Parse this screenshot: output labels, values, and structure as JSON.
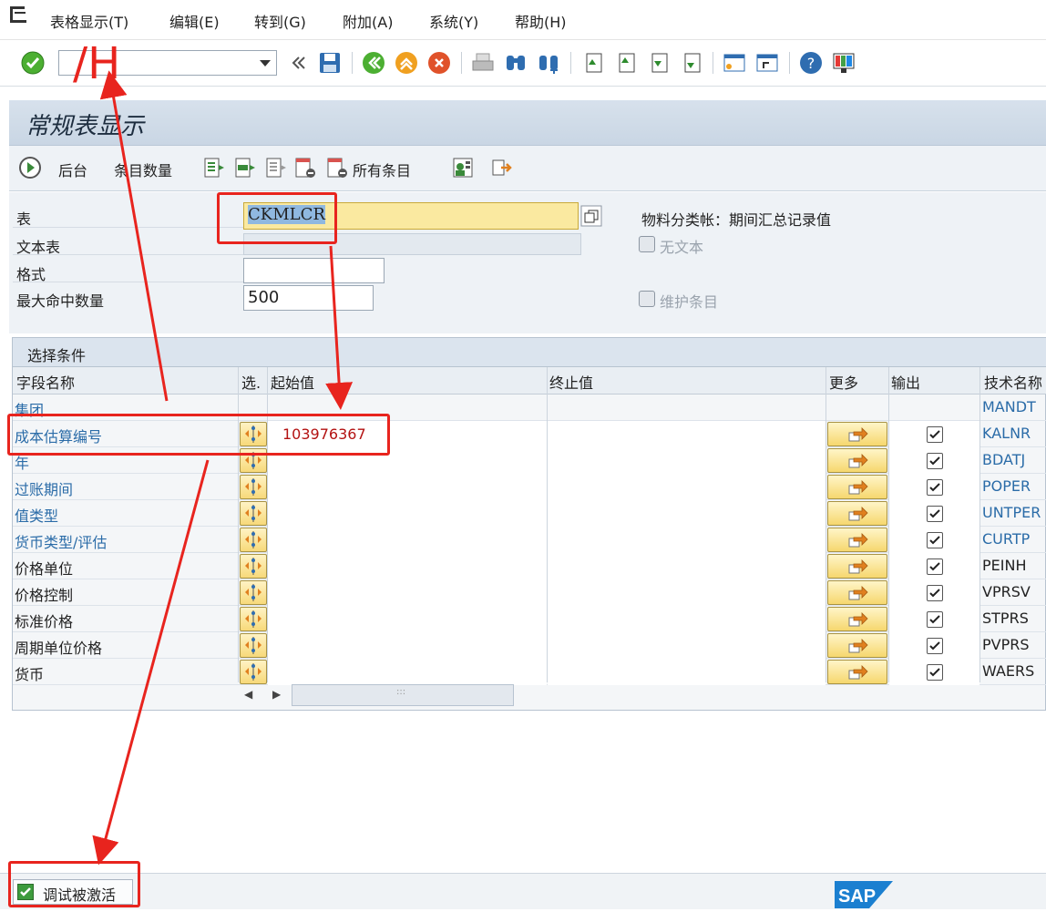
{
  "menu": {
    "items": [
      "表格显示(T)",
      "编辑(E)",
      "转到(G)",
      "附加(A)",
      "系统(Y)",
      "帮助(H)"
    ]
  },
  "toolbar": {
    "command_value": ""
  },
  "title": "常规表显示",
  "app_toolbar": {
    "background_label": "后台",
    "entry_count_label": "条目数量",
    "all_entries_label": "所有条目"
  },
  "form": {
    "table_label": "表",
    "table_value": "CKMLCR",
    "table_description": "物料分类帐：期间汇总记录值",
    "text_table_label": "文本表",
    "no_text_label": "无文本",
    "format_label": "格式",
    "max_hits_label": "最大命中数量",
    "max_hits_value": "500",
    "maintain_entries_label": "维护条目"
  },
  "selection": {
    "title": "选择条件",
    "columns": {
      "field_name": "字段名称",
      "select": "选.",
      "from_value": "起始值",
      "to_value": "终止值",
      "more": "更多",
      "output": "输出",
      "tech_name": "技术名称"
    },
    "rows": [
      {
        "name": "集团",
        "tech": "MANDT",
        "from": "",
        "blue": true,
        "editable": false
      },
      {
        "name": "成本估算编号",
        "tech": "KALNR",
        "from": "103976367",
        "blue": true,
        "editable": true
      },
      {
        "name": "年",
        "tech": "BDATJ",
        "from": "",
        "blue": true,
        "editable": true
      },
      {
        "name": "过账期间",
        "tech": "POPER",
        "from": "",
        "blue": true,
        "editable": true
      },
      {
        "name": "值类型",
        "tech": "UNTPER",
        "from": "",
        "blue": true,
        "editable": true
      },
      {
        "name": "货币类型/评估",
        "tech": "CURTP",
        "from": "",
        "blue": true,
        "editable": true
      },
      {
        "name": "价格单位",
        "tech": "PEINH",
        "from": "",
        "blue": false,
        "editable": true
      },
      {
        "name": "价格控制",
        "tech": "VPRSV",
        "from": "",
        "blue": false,
        "editable": true
      },
      {
        "name": "标准价格",
        "tech": "STPRS",
        "from": "",
        "blue": false,
        "editable": true
      },
      {
        "name": "周期单位价格",
        "tech": "PVPRS",
        "from": "",
        "blue": false,
        "editable": true
      },
      {
        "name": "货币",
        "tech": "WAERS",
        "from": "",
        "blue": false,
        "editable": true
      }
    ],
    "scroll_thumb_glyph": ":::"
  },
  "status": {
    "debug_label": "调试被激活",
    "logo_text": "SAP"
  },
  "annotation": {
    "command_text": "/H"
  },
  "colors": {
    "annotation_red": "#e8241e",
    "link_blue": "#2b6ca8",
    "value_red": "#b31212"
  }
}
